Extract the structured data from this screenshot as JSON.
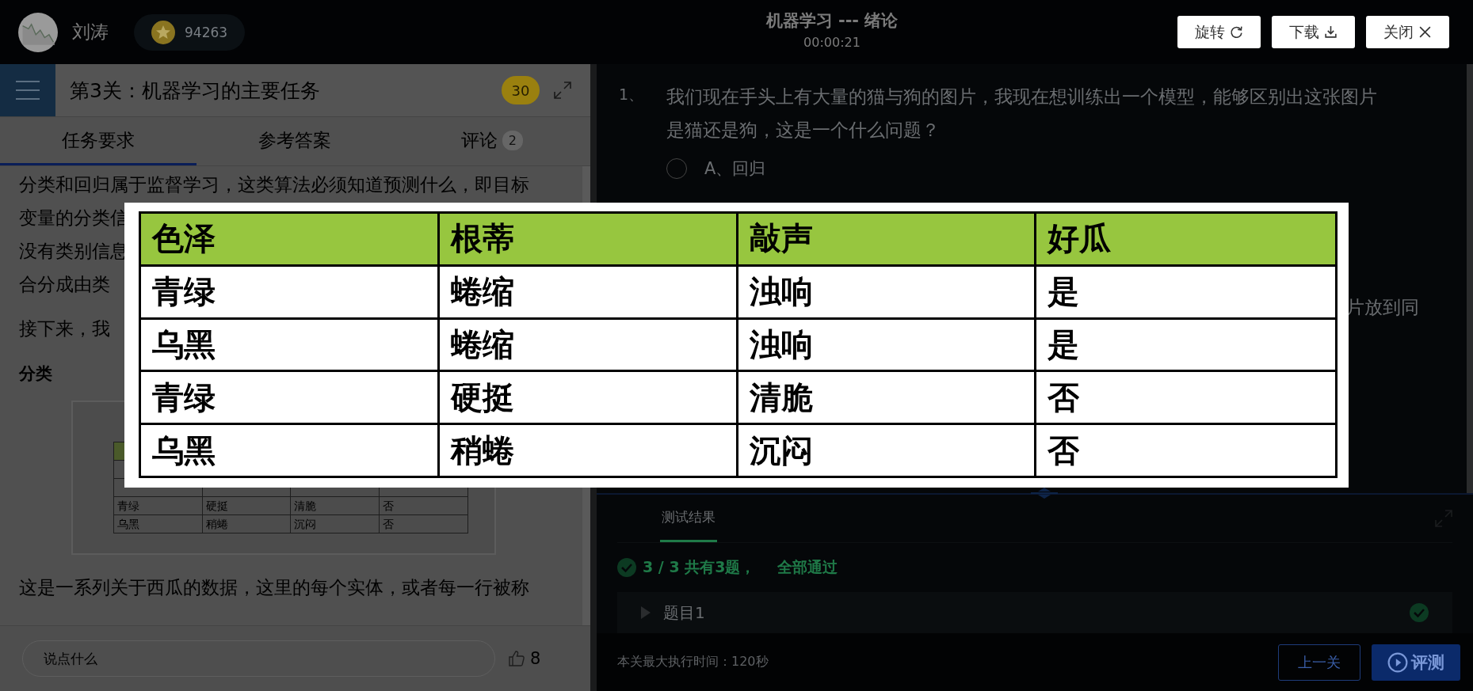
{
  "header": {
    "user_name": "刘涛",
    "coins": "94263",
    "course_title": "机器学习 --- 绪论",
    "timer": "00:00:21"
  },
  "viewer_buttons": [
    {
      "label": "旋转",
      "kind": "rotate"
    },
    {
      "label": "下载",
      "kind": "download"
    },
    {
      "label": "关闭",
      "kind": "close"
    }
  ],
  "task_panel": {
    "title": "第3关：机器学习的主要任务",
    "score": "30",
    "tabs": [
      {
        "label": "任务要求",
        "selected": true
      },
      {
        "label": "参考答案",
        "selected": false
      },
      {
        "label": "评论",
        "count": "2",
        "selected": false
      }
    ],
    "lines": [
      "分类和回归属于监督学习，这类算法必须知道预测什么，即目标",
      "变量的分类信",
      "没有类别信息",
      "合分成由类"
    ],
    "intro": "接下来，我",
    "heading": "分类",
    "figure_rows": [
      [
        "青绿",
        "硬挺",
        "清脆",
        "否"
      ],
      [
        "乌黑",
        "稍蜷",
        "沉闷",
        "否"
      ]
    ],
    "paragraph": "这是一系列关于西瓜的数据，这里的每个实体，或者每一行被称",
    "comment_placeholder": "说点什么",
    "likes": "8"
  },
  "question_panel": {
    "number": "1、",
    "question": "我们现在手头上有大量的猫与狗的图片，我现在想训练出一个模型，能够区别出这张图片是猫还是狗，这是一个什么问题？",
    "options": [
      {
        "label": "A、回归",
        "selected": false
      }
    ],
    "cut_text": "片放到同"
  },
  "test_results": {
    "tab": "测试结果",
    "score": "3 / 3",
    "count": "共有3题，",
    "status": "全部通过",
    "cases": [
      {
        "label": "题目1",
        "passed": true
      }
    ]
  },
  "footer": {
    "time_limit": "本关最大执行时间：120秒",
    "prev_button": "上一关",
    "run_button": "评测"
  },
  "image_viewer": {
    "columns": [
      "色泽",
      "根蒂",
      "敲声",
      "好瓜"
    ],
    "rows": [
      [
        "青绿",
        "蜷缩",
        "浊响",
        "是"
      ],
      [
        "乌黑",
        "蜷缩",
        "浊响",
        "是"
      ],
      [
        "青绿",
        "硬挺",
        "清脆",
        "否"
      ],
      [
        "乌黑",
        "稍蜷",
        "沉闷",
        "否"
      ]
    ]
  }
}
